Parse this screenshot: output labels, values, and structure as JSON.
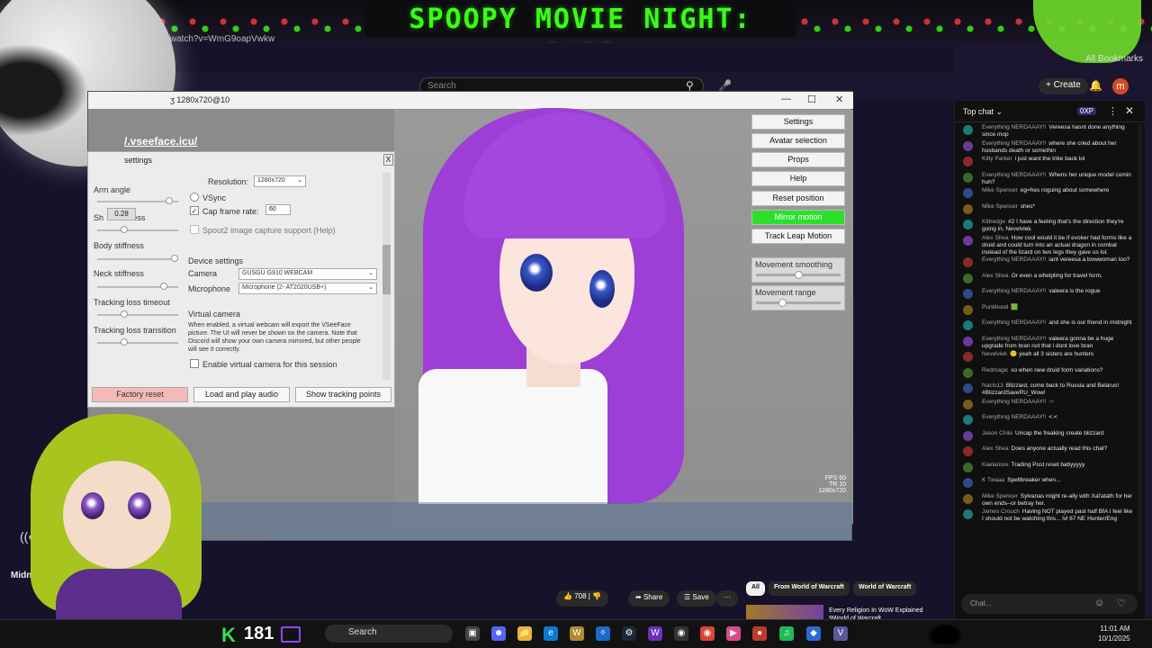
{
  "stream": {
    "title": "SPOOPY MOVIE NIGHT: 0/20",
    "url_fragment": "/watch?v=WmG9oapVwkw",
    "bookmarks": "All Bookmarks",
    "viewer_count": "181",
    "k_letter": "K",
    "notification_text": "Notification on",
    "channel_name": "Midn."
  },
  "youtube": {
    "search_placeholder": "Search",
    "create_label": "Create",
    "avatar_letter": "m",
    "likes": "708",
    "share_label": "Share",
    "save_label": "Save",
    "more_label": "···",
    "filters": [
      "All",
      "From World of Warcraft",
      "World of Warcraft"
    ],
    "rec_title": "Every Religion In WoW Explained 9World of Warcraft"
  },
  "vseeface": {
    "window_title": "ʒ 1280x720@10",
    "url": "/.vseeface.icu/",
    "buttons": [
      "Settings",
      "Avatar selection",
      "Props",
      "Help",
      "Reset position",
      "Mirror motion",
      "Track Leap Motion"
    ],
    "movement_smoothing": "Movement smoothing",
    "movement_range": "Movement range",
    "movement_smoothing_value": 0.5,
    "movement_range_value": 0.35,
    "fps": "FPS 60",
    "tr": "TR  10",
    "resolution_readout": "1280x720",
    "settings": {
      "title": "settings",
      "close": "X",
      "arm_angle": "Arm angle",
      "shoulder_stiffness": "Sh",
      "shoulder_stiffness_rest": "ffness",
      "tooltip_value": "0.28",
      "body_stiffness": "Body stiffness",
      "neck_stiffness": "Neck stiffness",
      "tracking_loss_timeout": "Tracking loss timeout",
      "tracking_loss_transition": "Tracking loss transition",
      "resolution_label": "Resolution:",
      "resolution_value": "1280x720",
      "vsync": "VSync",
      "cap_frame_rate": "Cap frame rate:",
      "cap_value": "60",
      "spout_label": "Spout2 image capture support (",
      "spout_help": "Help",
      "spout_close": ")",
      "device_settings": "Device settings",
      "camera_label": "Camera",
      "camera_value": "GUSGU G910 WEBCAM",
      "microphone_label": "Microphone",
      "microphone_value": "Microphone (2- AT2020USB+)",
      "virtual_camera": "Virtual camera",
      "virtual_camera_desc": "When enabled, a virtual webcam will export the VSeeFace picture. The UI will never be shown on the camera. Note that Discord will show your own camera mirrored, but other people will see it correctly.",
      "enable_virtual_camera": "Enable virtual camera for this session",
      "factory_reset": "Factory reset",
      "load_audio": "Load and play audio",
      "show_tracking": "Show tracking points"
    }
  },
  "chat": {
    "title": "Top chat",
    "xp_badge": "0XP",
    "input_placeholder": "Chat...",
    "messages": [
      {
        "author": "Everything NERDAAAY!!",
        "text": "Vereesa hasnt done anything since mop"
      },
      {
        "author": "Everything NERDAAAY!!",
        "text": "where she cried about her husbands death or somethin"
      },
      {
        "author": "Kitty Parker",
        "text": "i just want the trike back lol"
      },
      {
        "author": "Everything NERDAAAY!!",
        "text": "Whens her unique model comin huh?"
      },
      {
        "author": "Mike Spencer",
        "text": "eg=hes roguing about somewhere"
      },
      {
        "author": "Mike Spencer",
        "text": "shes*"
      },
      {
        "author": "Kittredge",
        "text": "#2 I have a feeling that's the direction they're going in, Nevelvlek."
      },
      {
        "author": "Alex Shea",
        "text": "How cool would it be if evoker had forms like a druid and could turn into an actual dragon in combat instead of the lizard on two legs they gave us lol."
      },
      {
        "author": "Everything NERDAAAY!!",
        "text": "iant vereesa a bowwoman too?"
      },
      {
        "author": "Alex Shea",
        "text": "Or even a whelpling for travel form."
      },
      {
        "author": "Everything NERDAAAY!!",
        "text": "valeera is the rogue"
      },
      {
        "author": "Punkhood",
        "text": "🟩"
      },
      {
        "author": "Everything NERDAAAY!!",
        "text": "and she is our friend in midnight"
      },
      {
        "author": "Everything NERDAAAY!!",
        "text": "valeera gonna be a huge upgrade from bran not that i dont love bran"
      },
      {
        "author": "Nevelvlek",
        "text": "🙂 yeah all 3 sisters are hunters"
      },
      {
        "author": "Redmagic",
        "text": "so when new druid form variations?"
      },
      {
        "author": "Naclo13",
        "text": "Blizzard, come back to Russia and Belarus! #BlizzardSaveRU_Wow!"
      },
      {
        "author": "Everything NERDAAAY!!",
        "text": ":~"
      },
      {
        "author": "Everything NERDAAAY!!",
        "text": "<.<"
      },
      {
        "author": "Jason Chile",
        "text": "Uncap the freaking create blizzard"
      },
      {
        "author": "Alex Shea",
        "text": "Does anyone actually read this chat?"
      },
      {
        "author": "Kaelanore",
        "text": "Trading Post reset babyyyyy"
      },
      {
        "author": "K Twaaa",
        "text": "Spellbreaker when..."
      },
      {
        "author": "Mike Spencer",
        "text": "Sylvanas might re-ally with Xal'atath for her own ends--or betray her."
      },
      {
        "author": "James Crouch",
        "text": "Having NOT played past half BfA I feel like I should not be watching this... lvl 67 NE Hunter/Eng"
      }
    ]
  },
  "taskbar": {
    "search_placeholder": "Search",
    "time": "11:01 AM",
    "date": "10/1/2025"
  },
  "colors": {
    "accent_green": "#39ff14",
    "mirror_on": "#2bdf2b",
    "factory_reset": "#f5b9b9",
    "hair": "#a447de"
  }
}
